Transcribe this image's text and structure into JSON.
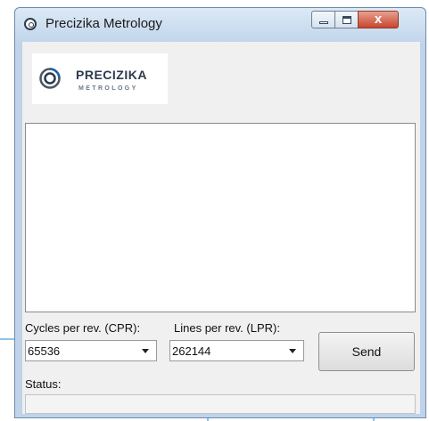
{
  "window": {
    "title": "Precizika Metrology",
    "close_glyph": "x",
    "icons": {
      "app": "precizika-logo-icon",
      "minimize": "minimize-icon",
      "maximize": "maximize-icon",
      "close": "close-icon"
    }
  },
  "logo": {
    "name": "PRECIZIKA",
    "subtitle": "METROLOGY"
  },
  "output": {
    "text": ""
  },
  "cpr": {
    "label": "Cycles per rev. (CPR):",
    "value": "65536"
  },
  "lpr": {
    "label": "Lines per rev. (LPR):",
    "value": "262144"
  },
  "send": {
    "label": "Send"
  },
  "status": {
    "label": "Status:",
    "value": ""
  },
  "colors": {
    "callout": "#8fc3e6",
    "frame": "#bfd3ea",
    "close_button": "#c8462f"
  }
}
